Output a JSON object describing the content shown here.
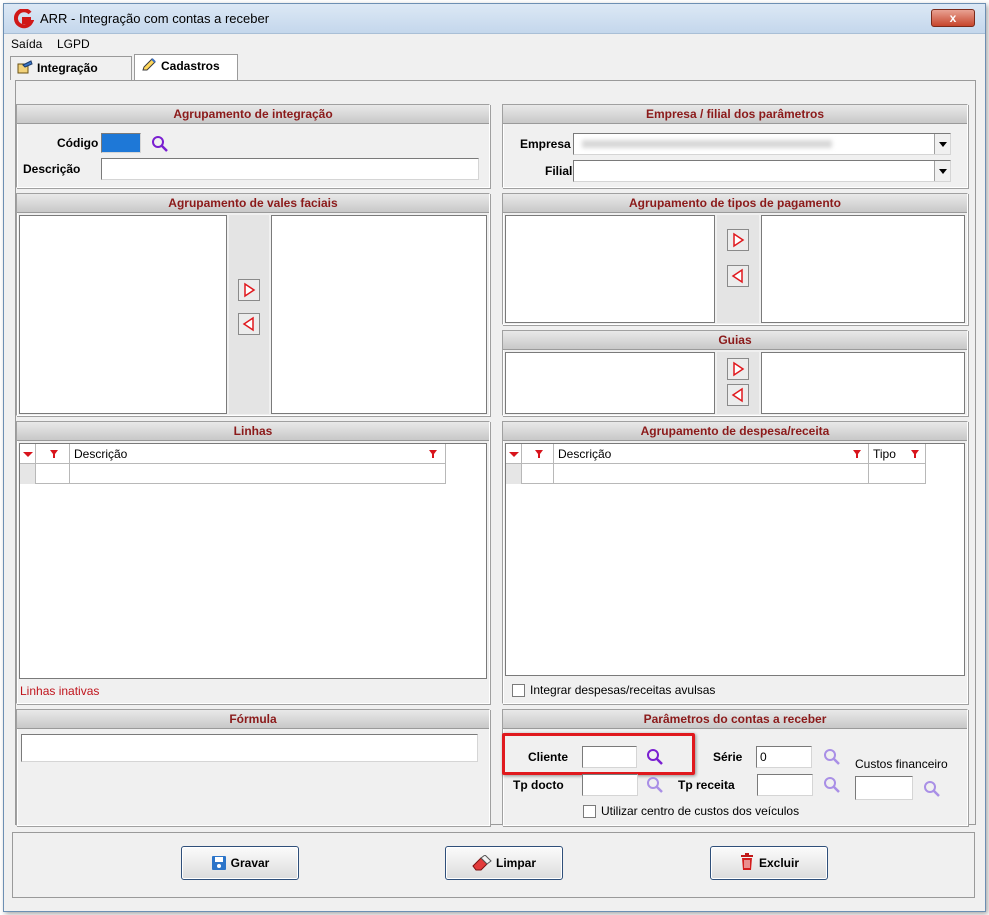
{
  "window": {
    "title": "ARR - Integração com contas a receber",
    "close_label": "x"
  },
  "menu": {
    "items": [
      "Saída",
      "LGPD"
    ]
  },
  "tabs": [
    {
      "label": "Integração"
    },
    {
      "label": "Cadastros"
    }
  ],
  "agrupamento_integracao": {
    "header": "Agrupamento de integração",
    "codigo_label": "Código",
    "descricao_label": "Descrição"
  },
  "empresa_filial": {
    "header": "Empresa / filial  dos parâmetros",
    "empresa_label": "Empresa",
    "filial_label": "Filial"
  },
  "vales_faciais": {
    "header": "Agrupamento de vales faciais"
  },
  "tipos_pagamento": {
    "header": "Agrupamento de tipos de pagamento"
  },
  "guias": {
    "header": "Guias"
  },
  "linhas": {
    "header": "Linhas",
    "col_descricao": "Descrição",
    "inactive_label": "Linhas inativas"
  },
  "despesa_receita": {
    "header": "Agrupamento de despesa/receita",
    "col_descricao": "Descrição",
    "col_tipo": "Tipo",
    "checkbox_label": "Integrar despesas/receitas avulsas"
  },
  "formula": {
    "header": "Fórmula"
  },
  "parametros": {
    "header": "Parâmetros do contas a receber",
    "cliente_label": "Cliente",
    "serie_label": "Série",
    "serie_value": "0",
    "custos_label": "Custos financeiro",
    "tp_docto_label": "Tp docto",
    "tp_receita_label": "Tp receita",
    "centro_custos_label": "Utilizar centro de custos dos veículos"
  },
  "buttons": {
    "gravar": "Gravar",
    "limpar": "Limpar",
    "excluir": "Excluir"
  },
  "colors": {
    "header_text": "#8b1a1a",
    "red_accent": "#e0191e",
    "search_icon": "#7a1fd1",
    "filter_icon": "#d8141c",
    "selected_field": "#1e78d7"
  }
}
